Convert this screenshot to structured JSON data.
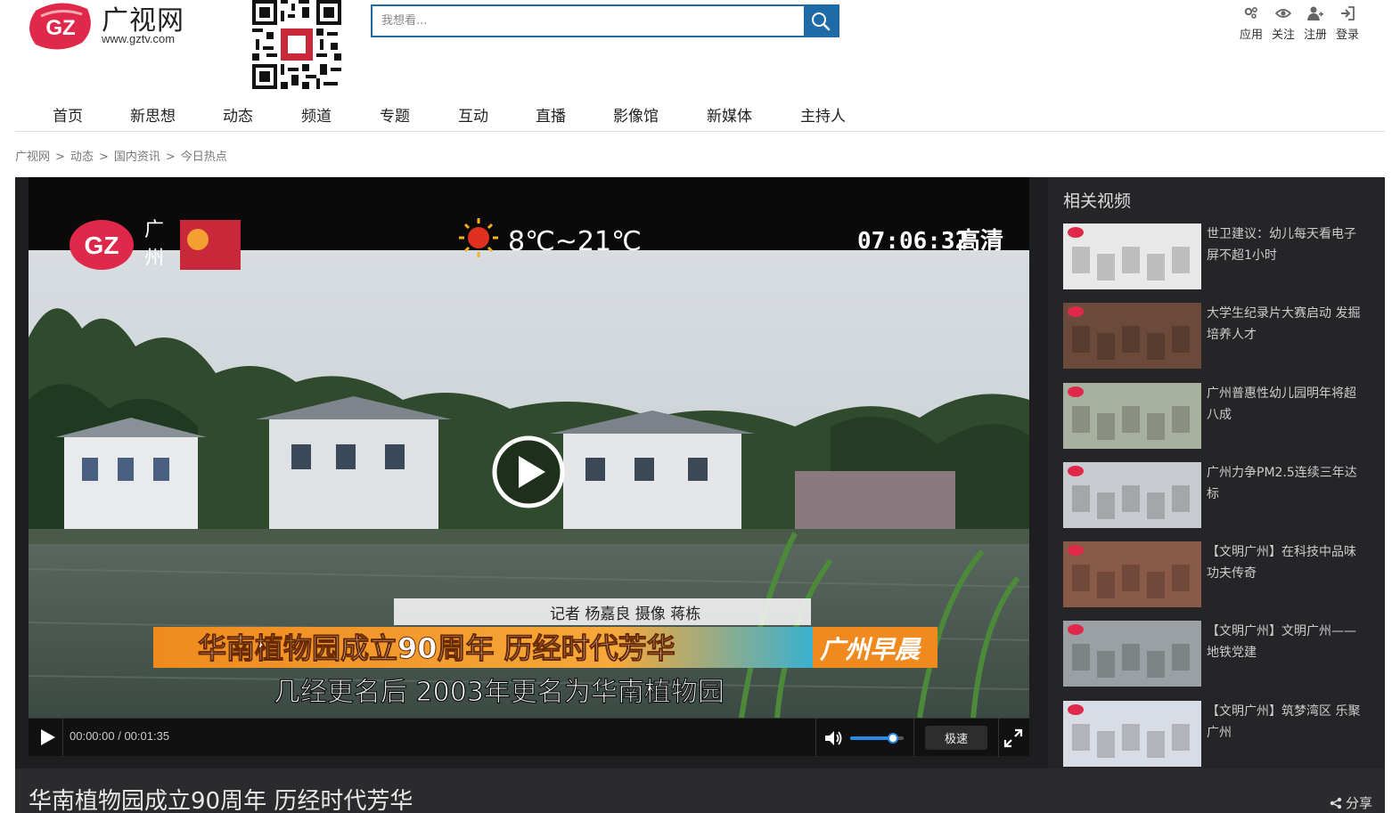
{
  "site": {
    "logo_badge": "GZ",
    "name": "广视网",
    "url": "www.gztv.com",
    "qr_label": "qr-code"
  },
  "search": {
    "placeholder": "我想看..."
  },
  "toolbar": [
    {
      "label": "应用",
      "icon": "apps-icon"
    },
    {
      "label": "关注",
      "icon": "eye-icon"
    },
    {
      "label": "注册",
      "icon": "add-user-icon"
    },
    {
      "label": "登录",
      "icon": "login-icon"
    }
  ],
  "nav": [
    {
      "label": "首页"
    },
    {
      "label": "新思想"
    },
    {
      "label": "动态"
    },
    {
      "label": "频道"
    },
    {
      "label": "专题"
    },
    {
      "label": "互动"
    },
    {
      "label": "直播"
    },
    {
      "label": "影像馆"
    },
    {
      "label": "新媒体"
    },
    {
      "label": "主持人"
    }
  ],
  "breadcrumb": {
    "items": [
      "广视网",
      "动态",
      "国内资讯",
      "今日热点"
    ],
    "separator": ">"
  },
  "video": {
    "overlay": {
      "logo": "GZ",
      "channel_city_1": "广",
      "channel_city_2": "州",
      "weather": "8℃~21℃",
      "clock": "07:06:32",
      "quality": "高清",
      "credits": "记者  杨嘉良        摄像  蒋栋",
      "headline": "华南植物园成立90周年  历经时代芳华",
      "program": "广州早晨",
      "subtitle": "几经更名后  2003年更名为华南植物园"
    },
    "current_time": "00:00:00",
    "duration": "00:01:35",
    "time_separator": " / ",
    "volume": 0.8,
    "speed_label": "极速"
  },
  "related": {
    "title": "相关视频",
    "items": [
      {
        "title": "世卫建议：幼儿每天看电子屏不超1小时",
        "thumb_color": "#e8e8e8"
      },
      {
        "title": "大学生纪录片大赛启动 发掘培养人才",
        "thumb_color": "#6b4a3a"
      },
      {
        "title": "广州普惠性幼儿园明年将超八成",
        "thumb_color": "#a8b0a0"
      },
      {
        "title": "广州力争PM2.5连续三年达标",
        "thumb_color": "#c8ccd0"
      },
      {
        "title": "【文明广州】在科技中品味功夫传奇",
        "thumb_color": "#8a5a48"
      },
      {
        "title": "【文明广州】文明广州——地铁党建",
        "thumb_color": "#9aa0a4"
      },
      {
        "title": "【文明广州】筑梦湾区 乐聚广州",
        "thumb_color": "#d8dce4"
      }
    ]
  },
  "page_title": "华南植物园成立90周年 历经时代芳华",
  "share_label": "分享",
  "colors": {
    "brand_red": "#e0294a",
    "search_blue": "#1e6ba8",
    "player_bg": "#1e1e20"
  }
}
